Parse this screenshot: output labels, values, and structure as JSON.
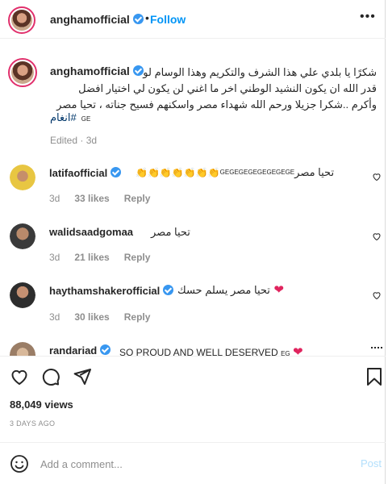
{
  "header": {
    "username": "anghamofficial",
    "separator": "•",
    "follow_label": "Follow",
    "more_label": "•••"
  },
  "caption": {
    "username": "anghamofficial",
    "line1": "شكرًا يا بلدي علي هذا الشرف والتكريم وهذا الوسام لو",
    "line2": "قدر الله ان يكون النشيد الوطني اخر ما اغني لن يكون لي اختيار افضل",
    "line3": "وأكرم ..شكرا جزيلا ورحم الله شهداء مصر واسكنهم فسيح جناته ، تحيا مصر",
    "hashtag": "#انغام",
    "flag": "GE",
    "meta": "Edited · 3d"
  },
  "comments": [
    {
      "username": "latifaofficial",
      "text_ltr": "GEGEGEGEGEGEGEGE",
      "text_rtl": "تحيا مصر",
      "age": "3d",
      "likes": "33 likes",
      "reply": "Reply"
    },
    {
      "username": "walidsaadgomaa",
      "text_rtl": "تحيا مصر",
      "age": "3d",
      "likes": "21 likes",
      "reply": "Reply"
    },
    {
      "username": "haythamshakerofficial",
      "text_rtl": "تحيا مصر يسلم حسك",
      "age": "3d",
      "likes": "30 likes",
      "reply": "Reply"
    },
    {
      "username": "randariad",
      "text": "SO PROUD AND WELL DESERVED",
      "flag": "EG"
    }
  ],
  "stats": {
    "views": "88,049 views",
    "posted": "3 DAYS AGO"
  },
  "comment_box": {
    "placeholder": "Add a comment...",
    "post_label": "Post"
  },
  "colors": {
    "accent": "#0095f6",
    "verified": "#3897f0",
    "heart_red": "#e0245e"
  }
}
